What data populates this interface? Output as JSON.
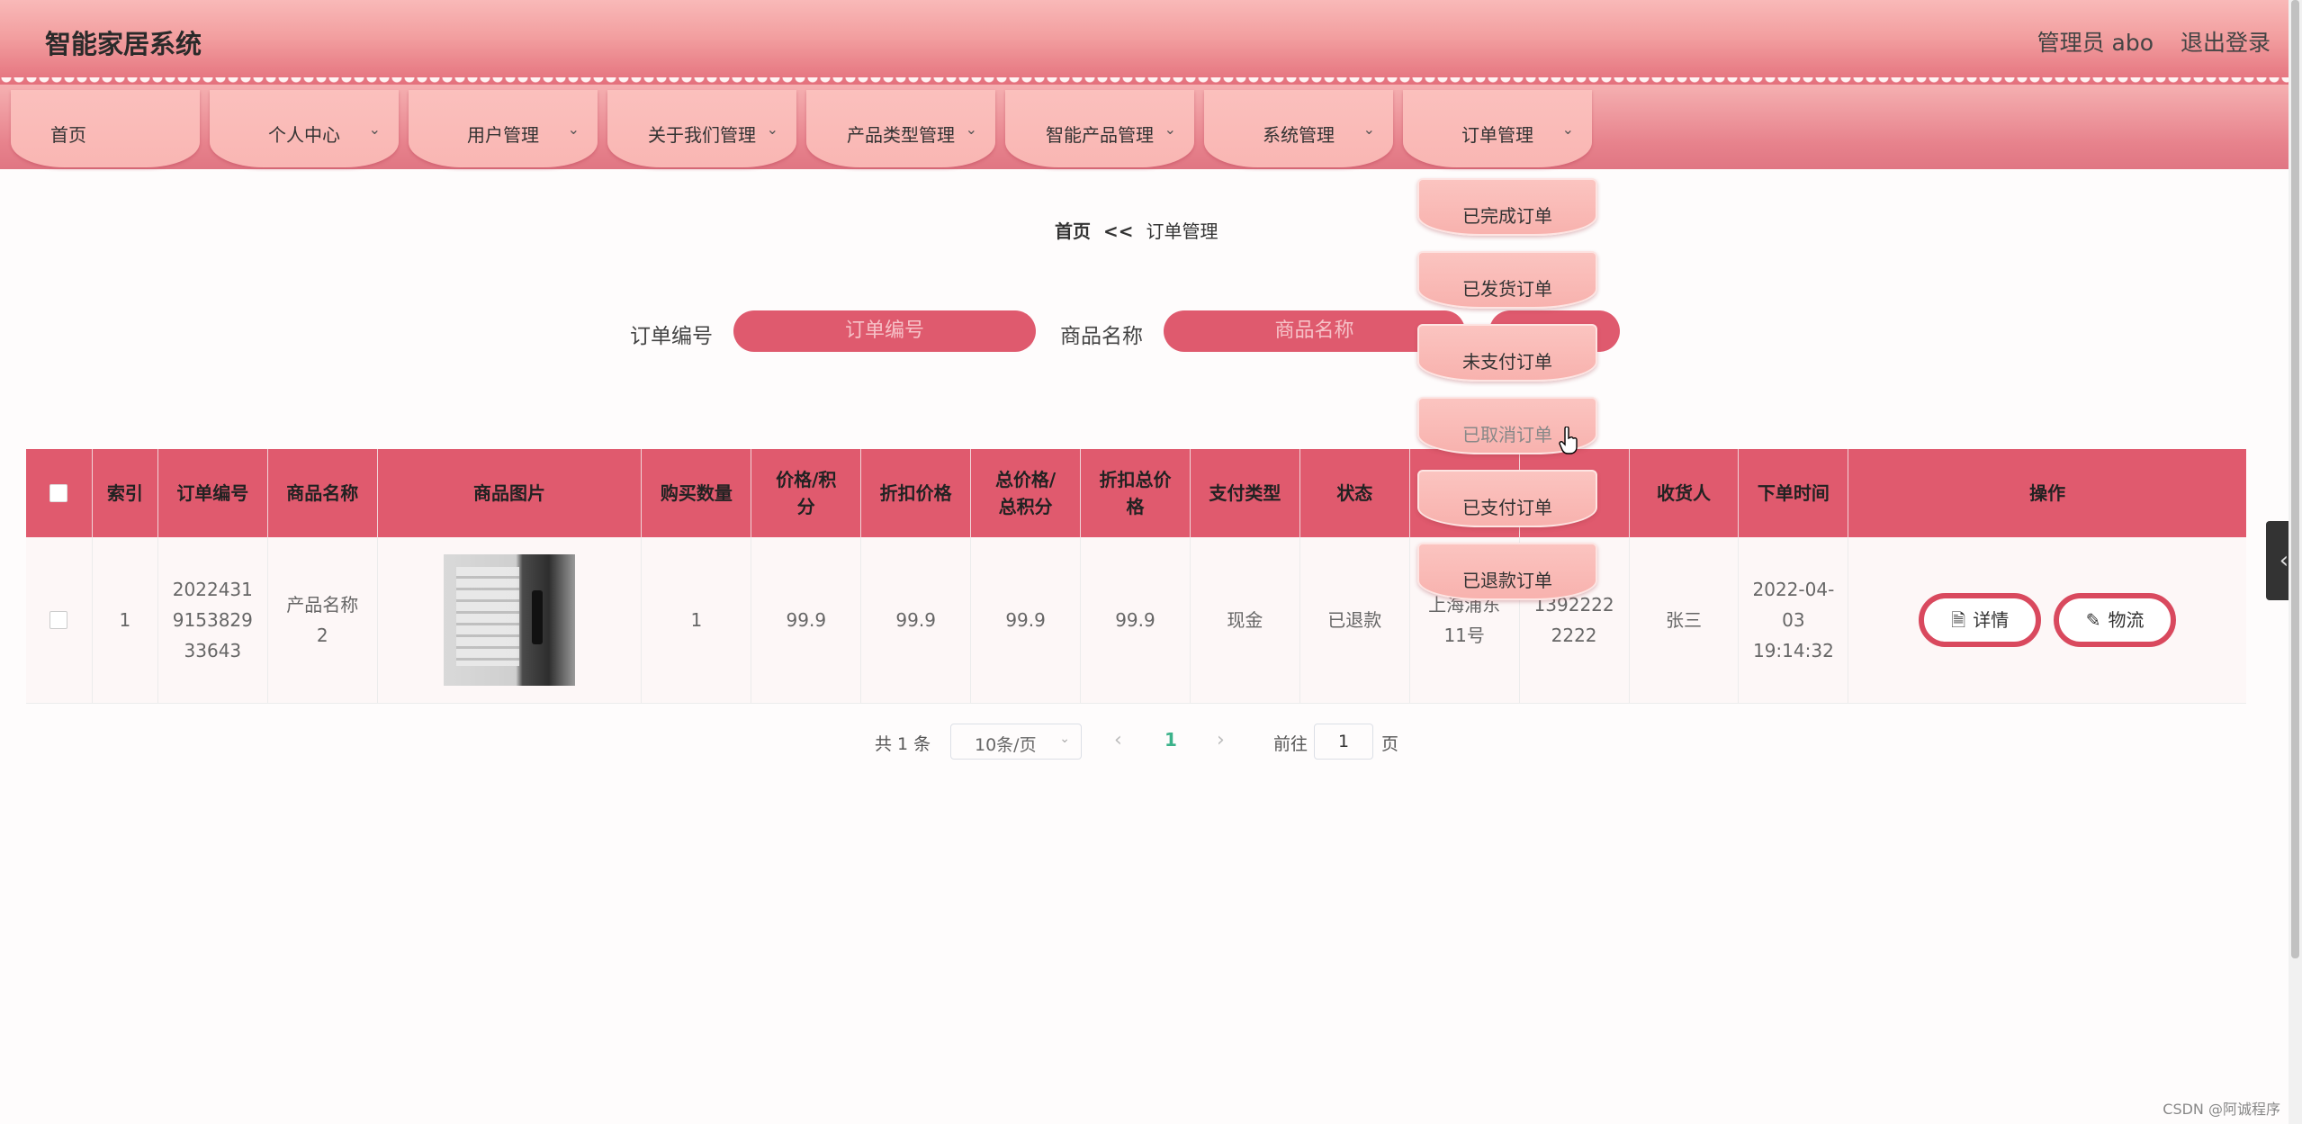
{
  "header": {
    "title": "智能家居系统",
    "admin": "管理员 abo",
    "logout": "退出登录"
  },
  "nav": [
    {
      "label": "首页",
      "chevron": false
    },
    {
      "label": "个人中心",
      "chevron": true
    },
    {
      "label": "用户管理",
      "chevron": true
    },
    {
      "label": "关于我们管理",
      "chevron": true
    },
    {
      "label": "产品类型管理",
      "chevron": true
    },
    {
      "label": "智能产品管理",
      "chevron": true
    },
    {
      "label": "系统管理",
      "chevron": true
    },
    {
      "label": "订单管理",
      "chevron": true
    }
  ],
  "breadcrumb": {
    "home": "首页",
    "sep": "<<",
    "current": "订单管理"
  },
  "search": {
    "order_label": "订单编号",
    "order_placeholder": "订单编号",
    "product_label": "商品名称",
    "product_placeholder": "商品名称"
  },
  "dropdown": [
    "已完成订单",
    "已发货订单",
    "未支付订单",
    "已取消订单",
    "已支付订单",
    "已退款订单"
  ],
  "table": {
    "headers": [
      "索引",
      "订单编号",
      "商品名称",
      "商品图片",
      "购买数量",
      "价格/积分",
      "折扣价格",
      "总价格/总积分",
      "折扣总价格",
      "支付类型",
      "状态",
      "",
      "",
      "收货人",
      "下单时间",
      "操作"
    ],
    "rows": [
      {
        "index": "1",
        "order_no": "20224319153829 33643",
        "product": "产品名称2",
        "qty": "1",
        "price": "99.9",
        "discount_price": "99.9",
        "total": "99.9",
        "discount_total": "99.9",
        "pay_type": "现金",
        "status": "已退款",
        "address": "上海浦东11号",
        "phone": "13922222222",
        "receiver": "张三",
        "time": "2022-04-03 19:14:32"
      }
    ],
    "actions": {
      "detail": "详情",
      "logistics": "物流"
    }
  },
  "pagination": {
    "total": "共 1 条",
    "page_size": "10条/页",
    "current": "1",
    "goto": "前往",
    "jump_value": "1",
    "page_unit": "页"
  },
  "watermark": "CSDN @阿诚程序",
  "colors": {
    "accent": "#e05a6e",
    "nav_tab": "#f9b6b3",
    "pager_active": "#3cb28a"
  }
}
